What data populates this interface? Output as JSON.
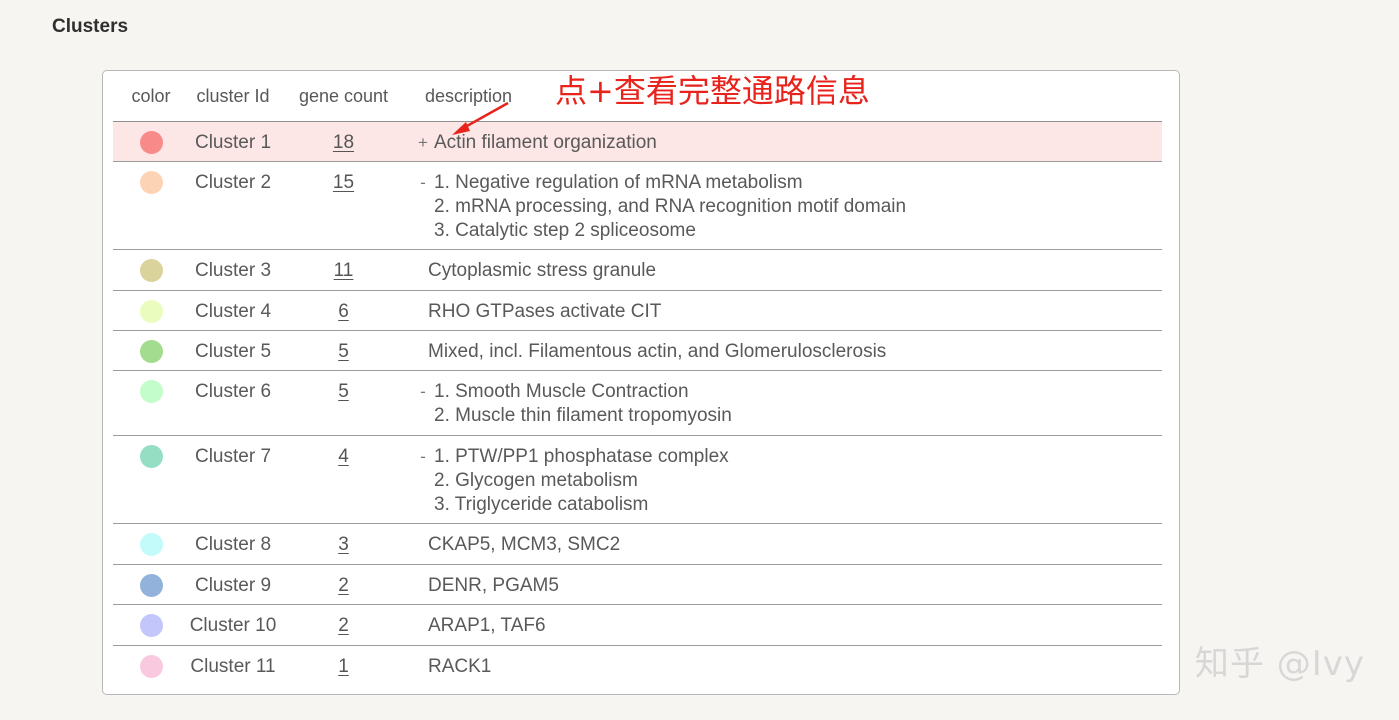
{
  "section": {
    "title": "Clusters"
  },
  "table": {
    "headers": {
      "color": "color",
      "cluster_id": "cluster Id",
      "gene_count": "gene count",
      "description": "description"
    },
    "rows": [
      {
        "color": "#f98a8a",
        "cluster_id": "Cluster 1",
        "gene_count": "18",
        "toggle": "+",
        "description_lines": [
          "Actin filament organization"
        ],
        "highlight": true
      },
      {
        "color": "#fdd3b5",
        "cluster_id": "Cluster 2",
        "gene_count": "15",
        "toggle": "-",
        "description_lines": [
          "1. Negative regulation of mRNA metabolism",
          "2. mRNA processing, and RNA recognition motif domain",
          "3. Catalytic step 2 spliceosome"
        ]
      },
      {
        "color": "#dad39b",
        "cluster_id": "Cluster 3",
        "gene_count": "11",
        "toggle": "",
        "description_lines": [
          "Cytoplasmic stress granule"
        ]
      },
      {
        "color": "#ebfdbe",
        "cluster_id": "Cluster 4",
        "gene_count": "6",
        "toggle": "",
        "description_lines": [
          "RHO GTPases activate CIT"
        ]
      },
      {
        "color": "#a4dc8f",
        "cluster_id": "Cluster 5",
        "gene_count": "5",
        "toggle": "",
        "description_lines": [
          "Mixed, incl. Filamentous actin, and Glomerulosclerosis"
        ]
      },
      {
        "color": "#c3fdcb",
        "cluster_id": "Cluster 6",
        "gene_count": "5",
        "toggle": "-",
        "description_lines": [
          "1. Smooth Muscle Contraction",
          "2. Muscle thin filament tropomyosin"
        ]
      },
      {
        "color": "#96dec3",
        "cluster_id": "Cluster 7",
        "gene_count": "4",
        "toggle": "-",
        "description_lines": [
          "1. PTW/PP1 phosphatase complex",
          "2. Glycogen metabolism",
          "3. Triglyceride catabolism"
        ]
      },
      {
        "color": "#c3fbfb",
        "cluster_id": "Cluster 8",
        "gene_count": "3",
        "toggle": "",
        "description_lines": [
          "CKAP5, MCM3, SMC2"
        ]
      },
      {
        "color": "#92b2db",
        "cluster_id": "Cluster 9",
        "gene_count": "2",
        "toggle": "",
        "description_lines": [
          "DENR, PGAM5"
        ]
      },
      {
        "color": "#c3c6fb",
        "cluster_id": "Cluster 10",
        "gene_count": "2",
        "toggle": "",
        "description_lines": [
          "ARAP1, TAF6"
        ]
      },
      {
        "color": "#f9c9e0",
        "cluster_id": "Cluster 11",
        "gene_count": "1",
        "toggle": "",
        "description_lines": [
          "RACK1"
        ]
      }
    ]
  },
  "annotation": {
    "text": "点+查看完整通路信息",
    "color": "#e8231c"
  },
  "watermark": {
    "text": "知乎 @Ivy"
  }
}
